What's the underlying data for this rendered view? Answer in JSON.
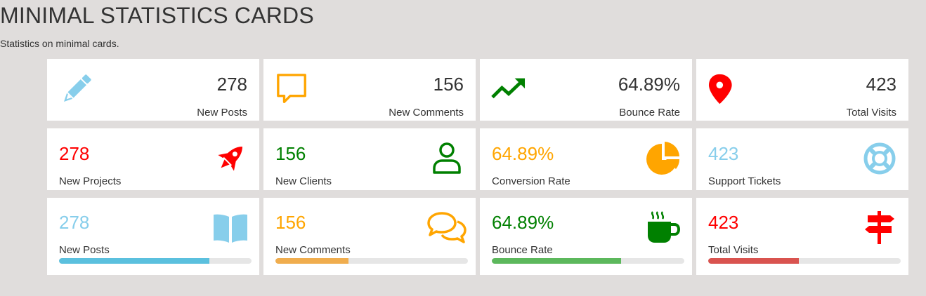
{
  "header": {
    "title": "MINIMAL STATISTICS CARDS",
    "subtitle": "Statistics on minimal cards."
  },
  "colors": {
    "blue": "#87ceeb",
    "orange": "#ffa500",
    "green": "#008000",
    "red": "#ff0000",
    "bar_blue": "#5bc0de",
    "bar_orange": "#f0ad4e",
    "bar_green": "#5cb85c",
    "bar_red": "#d9534f"
  },
  "row1": [
    {
      "value": "278",
      "label": "New Posts",
      "icon": "pencil-icon"
    },
    {
      "value": "156",
      "label": "New Comments",
      "icon": "speech-bubble-icon"
    },
    {
      "value": "64.89%",
      "label": "Bounce Rate",
      "icon": "trending-up-icon"
    },
    {
      "value": "423",
      "label": "Total Visits",
      "icon": "map-pin-icon"
    }
  ],
  "row2": [
    {
      "value": "278",
      "label": "New Projects",
      "icon": "rocket-icon"
    },
    {
      "value": "156",
      "label": "New Clients",
      "icon": "user-icon"
    },
    {
      "value": "64.89%",
      "label": "Conversion Rate",
      "icon": "pie-chart-icon"
    },
    {
      "value": "423",
      "label": "Support Tickets",
      "icon": "life-ring-icon"
    }
  ],
  "row3": [
    {
      "value": "278",
      "label": "New Posts",
      "icon": "book-icon",
      "progress": 0.78
    },
    {
      "value": "156",
      "label": "New Comments",
      "icon": "comments-icon",
      "progress": 0.38
    },
    {
      "value": "64.89%",
      "label": "Bounce Rate",
      "icon": "coffee-cup-icon",
      "progress": 0.67
    },
    {
      "value": "423",
      "label": "Total Visits",
      "icon": "signpost-icon",
      "progress": 0.47
    }
  ]
}
